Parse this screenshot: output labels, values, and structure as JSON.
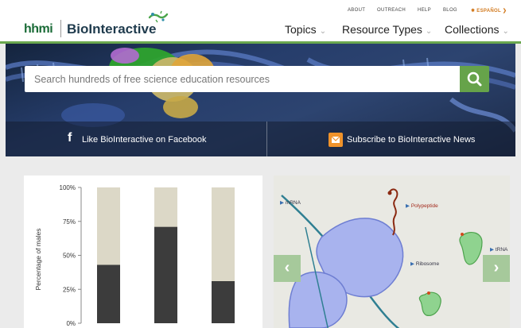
{
  "header": {
    "logo_hhmi": "hhmi",
    "logo_site": "BioInteractive",
    "utility_links": [
      "ABOUT",
      "OUTREACH",
      "HELP",
      "BLOG"
    ],
    "language": "ESPAÑOL",
    "nav": [
      "Topics",
      "Resource Types",
      "Collections"
    ]
  },
  "hero": {
    "search_placeholder": "Search hundreds of free science education resources",
    "facebook_text": "Like BioInteractive on Facebook",
    "subscribe_text": "Subscribe to BioInteractive News"
  },
  "chart_data": {
    "type": "bar",
    "ylabel": "Percentage of males",
    "ylim": [
      0,
      100
    ],
    "yticks": [
      "100%",
      "75%",
      "50%",
      "25%",
      "0%"
    ],
    "categories": [
      "",
      "",
      ""
    ],
    "series": [
      {
        "values": [
          43,
          71,
          31
        ],
        "color": "#3c3c3c"
      },
      {
        "values": [
          57,
          29,
          69
        ],
        "color": "#dcd8c7"
      }
    ]
  },
  "slider": {
    "labels": {
      "mrna": "mRNA",
      "polypeptide": "Polypeptide",
      "ribosome": "Ribosome",
      "trna": "tRNA"
    },
    "prev_icon": "chevron-left-icon",
    "next_icon": "chevron-right-icon"
  },
  "colors": {
    "brand_green": "#66a34a",
    "brand_dark": "#1f3b4d",
    "accent_orange": "#f0932b"
  }
}
